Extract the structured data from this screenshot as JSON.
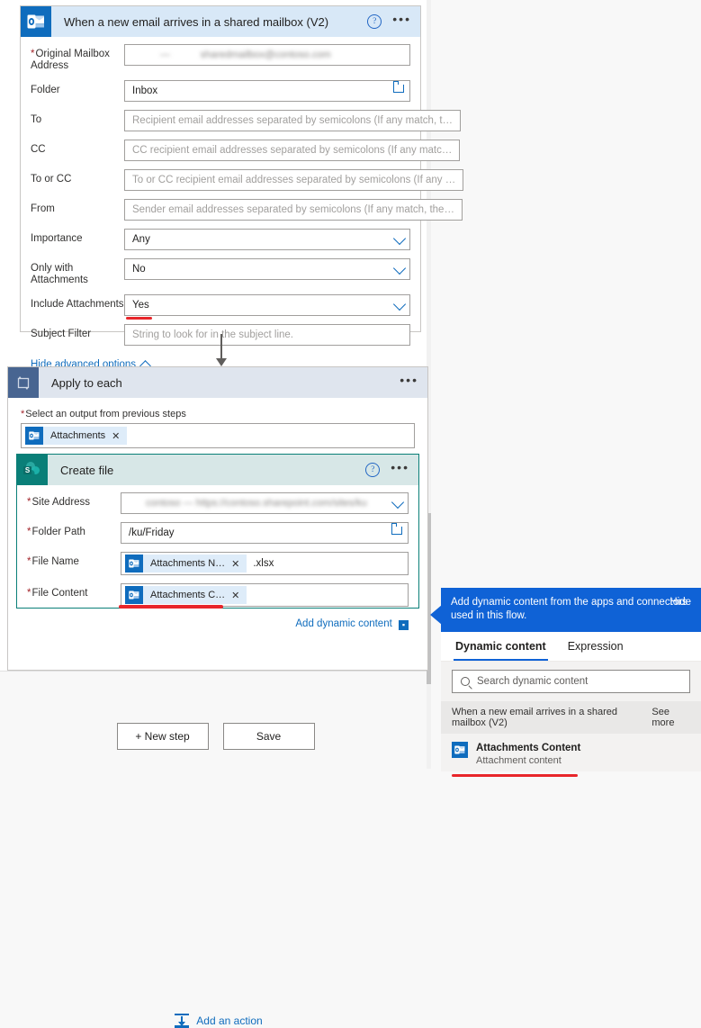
{
  "trigger": {
    "title": "When a new email arrives in a shared mailbox (V2)",
    "icon": "outlook-icon",
    "help_label": "?",
    "more_label": "•••",
    "fields": [
      {
        "label": "Original Mailbox Address",
        "required": true,
        "value": "",
        "redacted": true,
        "control": "text"
      },
      {
        "label": "Folder",
        "required": false,
        "value": "Inbox",
        "control": "folder-picker"
      },
      {
        "label": "To",
        "required": false,
        "placeholder": "Recipient email addresses separated by semicolons (If any match, t…",
        "control": "text"
      },
      {
        "label": "CC",
        "required": false,
        "placeholder": "CC recipient email addresses separated by semicolons (If any matc…",
        "control": "text"
      },
      {
        "label": "To or CC",
        "required": false,
        "placeholder": "To or CC recipient email addresses separated by semicolons (If any …",
        "control": "text"
      },
      {
        "label": "From",
        "required": false,
        "placeholder": "Sender email addresses separated by semicolons (If any match, the…",
        "control": "text"
      },
      {
        "label": "Importance",
        "required": false,
        "value": "Any",
        "control": "dropdown"
      },
      {
        "label": "Only with Attachments",
        "required": false,
        "value": "No",
        "control": "dropdown"
      },
      {
        "label": "Include Attachments",
        "required": false,
        "value": "Yes",
        "control": "dropdown",
        "highlighted": true
      },
      {
        "label": "Subject Filter",
        "required": false,
        "placeholder": "String to look for in the subject line.",
        "control": "text"
      }
    ],
    "advanced_link": "Hide advanced options"
  },
  "loop": {
    "title": "Apply to each",
    "icon": "loop-icon",
    "more_label": "•••",
    "select_output_label": "Select an output from previous steps",
    "token": {
      "label": "Attachments",
      "remove": "✕",
      "icon": "outlook-icon"
    }
  },
  "create_file": {
    "title": "Create file",
    "icon": "sharepoint-icon",
    "help_label": "?",
    "more_label": "•••",
    "fields": {
      "site_address": {
        "label": "Site Address",
        "value": "",
        "redacted": true
      },
      "folder_path": {
        "label": "Folder Path",
        "value": "/ku/Friday"
      },
      "file_name": {
        "label": "File Name",
        "token": {
          "label": "Attachments N…",
          "remove": "✕",
          "icon": "outlook-icon"
        },
        "suffix": ".xlsx"
      },
      "file_content": {
        "label": "File Content",
        "token": {
          "label": "Attachments C…",
          "remove": "✕",
          "icon": "outlook-icon"
        },
        "highlighted": true
      }
    },
    "add_dynamic_content": "Add dynamic content",
    "add_dynamic_badge": "▪"
  },
  "canvas": {
    "add_action": "Add an action",
    "new_step_button": "+ New step",
    "save_button": "Save"
  },
  "dynamic_panel": {
    "banner_text": "Add dynamic content from the apps and connectors used in this flow.",
    "hide_label": "Hide",
    "tabs": [
      {
        "label": "Dynamic content",
        "selected": true
      },
      {
        "label": "Expression",
        "selected": false
      }
    ],
    "search_placeholder": "Search dynamic content",
    "group": {
      "title": "When a new email arrives in a shared mailbox (V2)",
      "see_more": "See more"
    },
    "items": [
      {
        "name": "Attachments Content",
        "description": "Attachment content",
        "icon": "outlook-icon",
        "highlighted": true
      }
    ]
  },
  "colors": {
    "trigger_header": "#d8e8f7",
    "loop_header": "#dfe5ee",
    "createfile_header": "#d7e7e7",
    "outlook_blue": "#0f6cbd",
    "sharepoint_teal": "#0a7f78",
    "loop_slate": "#486591",
    "accent_link": "#0f6cbd",
    "banner_blue": "#0f62d6",
    "annotation_red": "#e8262b",
    "required_red": "#a4262c"
  }
}
